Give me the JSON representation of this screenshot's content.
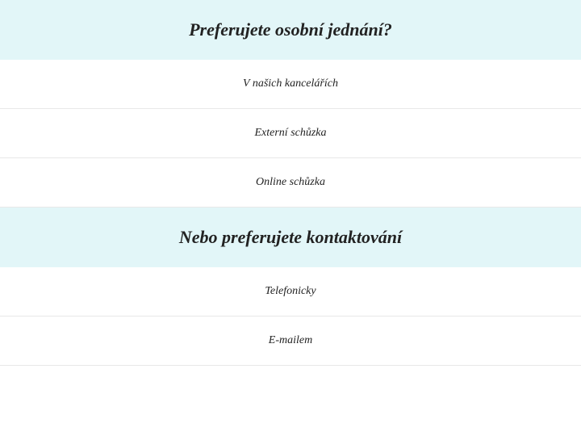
{
  "sections": [
    {
      "heading": "Preferujete osobní jednání?",
      "options": [
        "V našich kancelářích",
        "Externí schůzka",
        "Online schůzka"
      ]
    },
    {
      "heading": "Nebo preferujete kontaktování",
      "options": [
        "Telefonicky",
        "E-mailem"
      ]
    }
  ]
}
